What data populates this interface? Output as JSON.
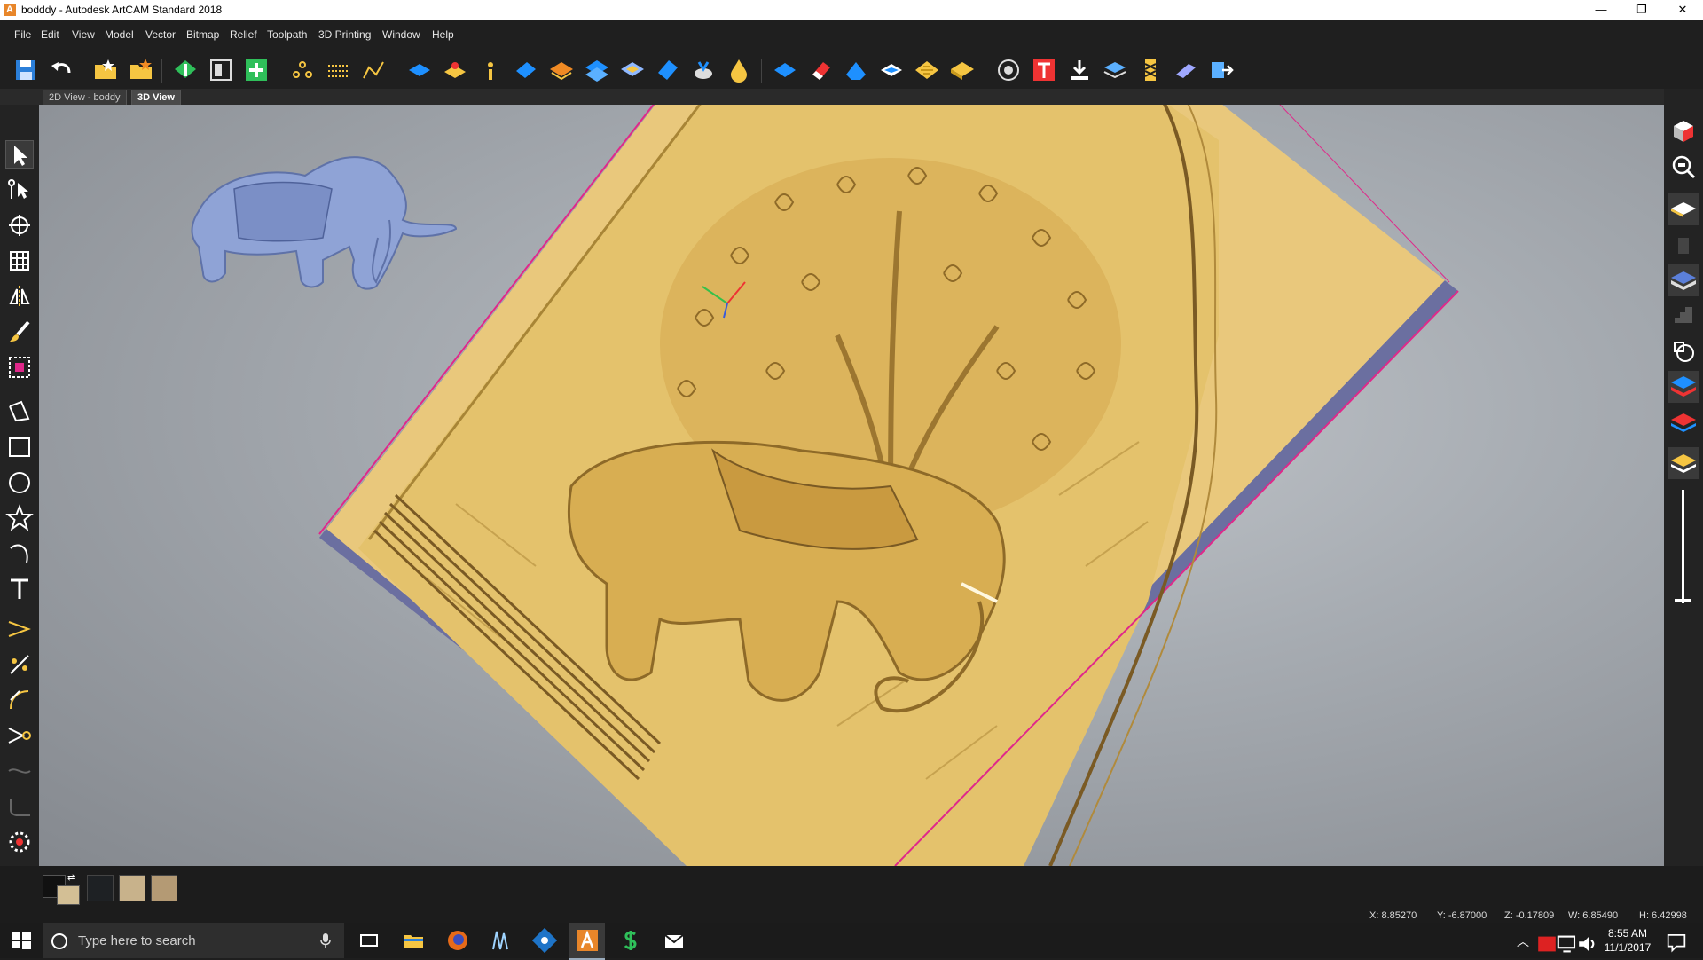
{
  "window": {
    "title": "bodddy - Autodesk ArtCAM Standard 2018",
    "app_icon_letter": "A",
    "minimize": "—",
    "restore": "❐",
    "close": "✕"
  },
  "menu": [
    "File",
    "Edit",
    "View",
    "Model",
    "Vector",
    "Bitmap",
    "Relief",
    "Toolpath",
    "3D Printing",
    "Window",
    "Help"
  ],
  "tabs": [
    {
      "label": "2D View - boddy",
      "active": false
    },
    {
      "label": "3D View",
      "active": true
    }
  ],
  "view_controls": {
    "dropdown": "▾",
    "close": "✕"
  },
  "status": {
    "x": "X: 8.85270",
    "y": "Y: -6.87000",
    "z": "Z: -0.17809",
    "w": "W: 6.85490",
    "h": "H: 6.42998"
  },
  "taskbar": {
    "search_placeholder": "Type here to search",
    "time": "8:55 AM",
    "date": "11/1/2017"
  },
  "colors": {
    "relief_gold": "#e4c26c",
    "elephant_blue": "#8fa3d6",
    "border_pink": "#e0288a",
    "toolbar_blue": "#1e90ff"
  }
}
